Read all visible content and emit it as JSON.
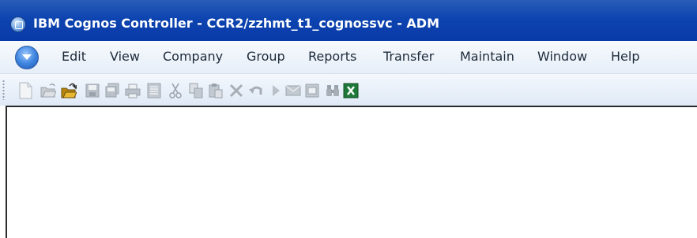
{
  "window": {
    "title": "IBM Cognos Controller - CCR2/zzhmt_t1_cognossvc - ADM"
  },
  "menu": {
    "items": [
      {
        "label": "Edit"
      },
      {
        "label": "View"
      },
      {
        "label": "Company"
      },
      {
        "label": "Group"
      },
      {
        "label": "Reports"
      },
      {
        "label": "Transfer"
      },
      {
        "label": "Maintain"
      },
      {
        "label": "Window"
      },
      {
        "label": "Help"
      }
    ]
  },
  "toolbar": {
    "buttons": [
      {
        "icon": "new-document-icon"
      },
      {
        "icon": "open-folder-icon"
      },
      {
        "icon": "open-folder-active-icon"
      },
      {
        "icon": "save-icon"
      },
      {
        "icon": "save-all-icon"
      },
      {
        "icon": "print-icon"
      },
      {
        "icon": "print-preview-icon"
      },
      {
        "icon": "cut-icon"
      },
      {
        "icon": "copy-icon"
      },
      {
        "icon": "paste-icon"
      },
      {
        "icon": "delete-icon"
      },
      {
        "icon": "undo-icon"
      },
      {
        "icon": "run-icon"
      },
      {
        "icon": "mail-icon"
      },
      {
        "icon": "form-icon"
      },
      {
        "icon": "find-icon"
      },
      {
        "icon": "excel-icon"
      }
    ]
  },
  "colors": {
    "titlebar": "#0d44b0",
    "menubar": "#e6eef8",
    "toolbar": "#dfe9f6",
    "disabled_icon": "#b9c0c8",
    "excel_green": "#1f7a3a"
  }
}
